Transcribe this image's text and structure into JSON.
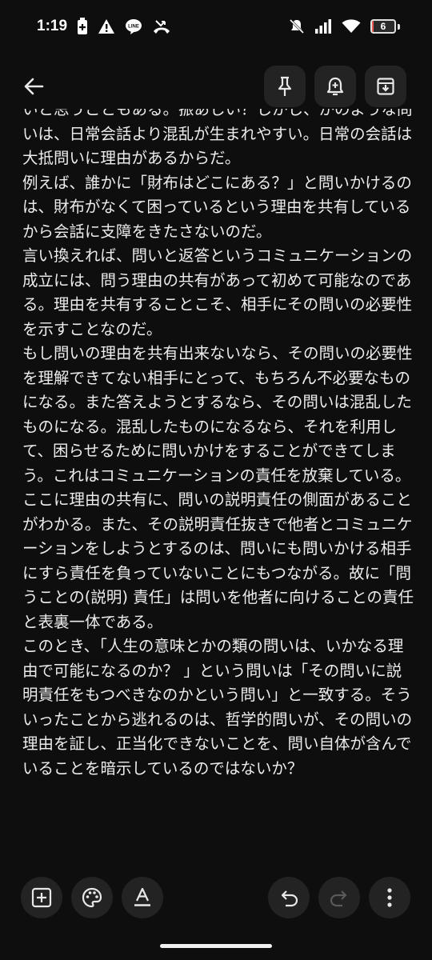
{
  "status_bar": {
    "time": "1:19",
    "battery_level": "6",
    "battery_color": "#e85a4f",
    "icons_left": [
      "battery-saver-icon",
      "warning-icon",
      "line-app-icon",
      "missed-call-icon"
    ],
    "icons_right": [
      "mute-icon",
      "signal-icon",
      "wifi-icon",
      "battery-icon"
    ]
  },
  "toolbar": {
    "icons": [
      "back-arrow-icon",
      "pin-icon",
      "reminder-bell-icon",
      "archive-icon"
    ]
  },
  "note": {
    "text": "いと思うこともある。振あしい？しかし、かのような問いは、日常会話より混乱が生まれやすい。日常の会話は大抵問いに理由があるからだ。\n例えば、誰かに「財布はどこにある？」と問いかけるのは、財布がなくて困っているという理由を共有しているから会話に支障をきたさないのだ。\n言い換えれば、問いと返答というコミュニケーションの成立には、問う理由の共有があって初めて可能なのである。理由を共有することこそ、相手にその問いの必要性を示すことなのだ。\nもし問いの理由を共有出来ないなら、その問いの必要性を理解できてない相手にとって、もちろん不必要なものになる。また答えようとするなら、その問いは混乱したものになる。混乱したものになるなら、それを利用して、困らせるために問いかけをすることができてしまう。これはコミュニケーションの責任を放棄している。ここに理由の共有に、問いの説明責任の側面があることがわかる。また、その説明責任抜きで他者とコミュニケーションをしようとするのは、問いにも問いかける相手にすら責任を負っていないことにもつながる。故に「問うことの(説明) 責任」は問いを他者に向けることの責任と表裏一体である。\nこのとき、「人生の意味とかの類の問いは、いかなる理由で可能になるのか？ 」という問いは「その問いに説明責任をもつべきなのかという問い」と一致する。そういったことから逃れるのは、哲学的問いが、その問いの理由を証し、正当化できないことを、問い自体が含んでいることを暗示しているのではないか？"
  },
  "bottom_toolbar": {
    "icons": [
      "add-box-icon",
      "palette-icon",
      "text-format-icon",
      "undo-icon",
      "redo-icon",
      "more-vert-icon"
    ]
  }
}
